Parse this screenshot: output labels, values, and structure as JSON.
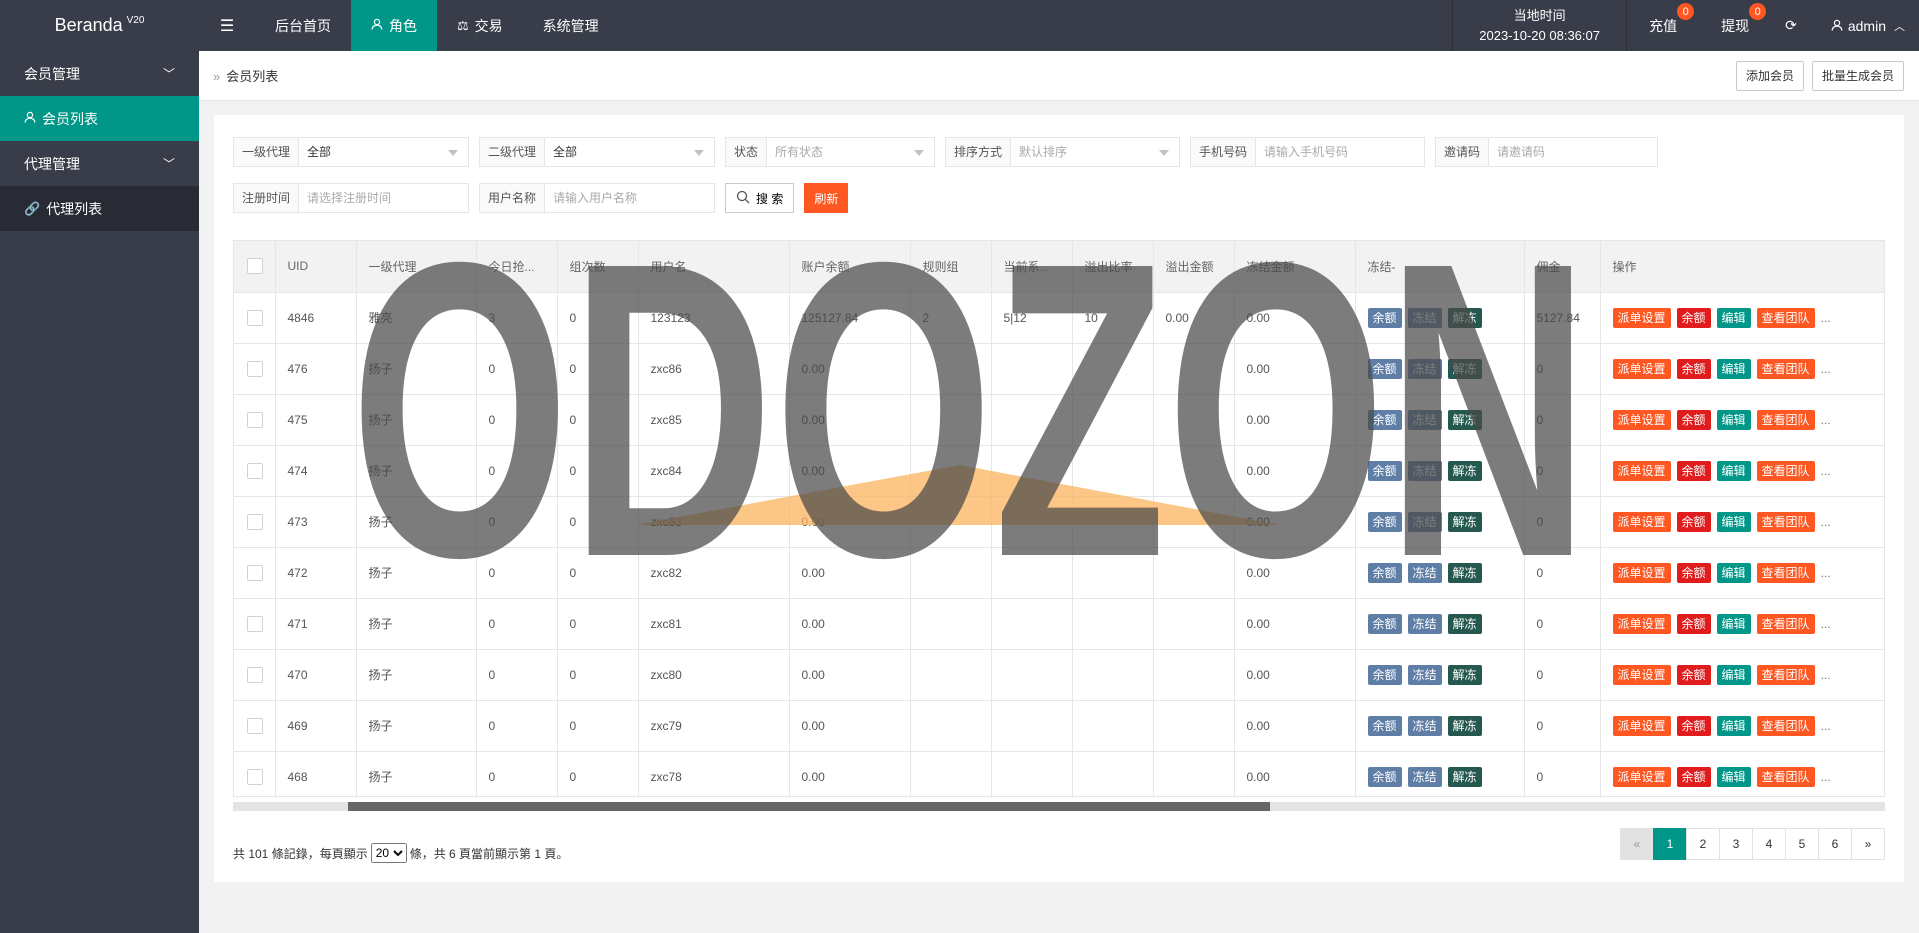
{
  "brand": {
    "name": "Beranda",
    "version": "V20"
  },
  "nav": {
    "items": [
      {
        "label": "后台首页",
        "icon": "none"
      },
      {
        "label": "角色",
        "icon": "user-icon",
        "active": true
      },
      {
        "label": "交易",
        "icon": "scale-icon"
      },
      {
        "label": "系统管理",
        "icon": "none"
      }
    ]
  },
  "header": {
    "time_label": "当地时间",
    "time_value": "2023-10-20 08:36:07",
    "recharge_label": "充值",
    "recharge_badge": "0",
    "withdraw_label": "提现",
    "withdraw_badge": "0",
    "user": "admin"
  },
  "sidebar": {
    "groups": [
      {
        "label": "会员管理",
        "items": [
          {
            "label": "会员列表",
            "active": true
          }
        ]
      },
      {
        "label": "代理管理",
        "items": [
          {
            "label": "代理列表"
          }
        ]
      }
    ]
  },
  "breadcrumb": {
    "current": "会员列表"
  },
  "actions": {
    "add_member": "添加会员",
    "batch_generate": "批量生成会员"
  },
  "filters": {
    "agent1_label": "一级代理",
    "agent1_value": "全部",
    "agent2_label": "二级代理",
    "agent2_value": "全部",
    "status_label": "状态",
    "status_placeholder": "所有状态",
    "sort_label": "排序方式",
    "sort_placeholder": "默认排序",
    "phone_label": "手机号码",
    "phone_placeholder": "请输入手机号码",
    "invite_label": "邀请码",
    "invite_placeholder": "请邀请码",
    "regtime_label": "注册时间",
    "regtime_placeholder": "请选择注册时间",
    "username_label": "用户名称",
    "username_placeholder": "请输入用户名称",
    "search_label": "搜 索",
    "refresh_label": "刷新"
  },
  "table": {
    "headers": [
      "UID",
      "一级代理",
      "今日抢...",
      "组次数",
      "用户名",
      "账户余额",
      "规则组",
      "当前系...",
      "溢出比率",
      "溢出金额",
      "冻结金额",
      "冻结-",
      "佣金",
      "操作"
    ],
    "action_labels": {
      "balance": "余额",
      "freeze": "冻结",
      "unfreeze": "解冻",
      "dispatch": "派单设置",
      "edit": "编辑",
      "team": "查看团队",
      "more": "..."
    },
    "rows": [
      {
        "uid": "4846",
        "agent": "雅亮",
        "today": "3",
        "groups": "0",
        "username": "123123",
        "balance": "125127.84",
        "rule": "2",
        "current": "5|12",
        "overflow_rate": "10",
        "overflow_amount": "0.00",
        "frozen": "0.00",
        "commission": "5127.84"
      },
      {
        "uid": "476",
        "agent": "扬子",
        "today": "0",
        "groups": "0",
        "username": "zxc86",
        "balance": "0.00",
        "rule": "",
        "current": "",
        "overflow_rate": "",
        "overflow_amount": "",
        "frozen": "0.00",
        "commission": "0"
      },
      {
        "uid": "475",
        "agent": "扬子",
        "today": "0",
        "groups": "0",
        "username": "zxc85",
        "balance": "0.00",
        "rule": "",
        "current": "",
        "overflow_rate": "",
        "overflow_amount": "",
        "frozen": "0.00",
        "commission": "0"
      },
      {
        "uid": "474",
        "agent": "扬子",
        "today": "0",
        "groups": "0",
        "username": "zxc84",
        "balance": "0.00",
        "rule": "",
        "current": "",
        "overflow_rate": "",
        "overflow_amount": "",
        "frozen": "0.00",
        "commission": "0"
      },
      {
        "uid": "473",
        "agent": "扬子",
        "today": "0",
        "groups": "0",
        "username": "zxc83",
        "balance": "0.00",
        "rule": "",
        "current": "",
        "overflow_rate": "",
        "overflow_amount": "",
        "frozen": "0.00",
        "commission": "0"
      },
      {
        "uid": "472",
        "agent": "扬子",
        "today": "0",
        "groups": "0",
        "username": "zxc82",
        "balance": "0.00",
        "rule": "",
        "current": "",
        "overflow_rate": "",
        "overflow_amount": "",
        "frozen": "0.00",
        "commission": "0"
      },
      {
        "uid": "471",
        "agent": "扬子",
        "today": "0",
        "groups": "0",
        "username": "zxc81",
        "balance": "0.00",
        "rule": "",
        "current": "",
        "overflow_rate": "",
        "overflow_amount": "",
        "frozen": "0.00",
        "commission": "0"
      },
      {
        "uid": "470",
        "agent": "扬子",
        "today": "0",
        "groups": "0",
        "username": "zxc80",
        "balance": "0.00",
        "rule": "",
        "current": "",
        "overflow_rate": "",
        "overflow_amount": "",
        "frozen": "0.00",
        "commission": "0"
      },
      {
        "uid": "469",
        "agent": "扬子",
        "today": "0",
        "groups": "0",
        "username": "zxc79",
        "balance": "0.00",
        "rule": "",
        "current": "",
        "overflow_rate": "",
        "overflow_amount": "",
        "frozen": "0.00",
        "commission": "0"
      },
      {
        "uid": "468",
        "agent": "扬子",
        "today": "0",
        "groups": "0",
        "username": "zxc78",
        "balance": "0.00",
        "rule": "",
        "current": "",
        "overflow_rate": "",
        "overflow_amount": "",
        "frozen": "0.00",
        "commission": "0"
      }
    ]
  },
  "pagination": {
    "info_prefix": "共 101 條記錄，每頁顯示",
    "page_size": "20",
    "info_suffix": "條，共 6 頁當前顯示第 1 頁。",
    "prev": "«",
    "next": "»",
    "pages": [
      "1",
      "2",
      "3",
      "4",
      "5",
      "6"
    ],
    "current": "1"
  },
  "watermark": {
    "text": "ODOZON"
  },
  "colors": {
    "header_bg": "#393d49",
    "accent": "#009688",
    "danger": "#ff5722"
  }
}
